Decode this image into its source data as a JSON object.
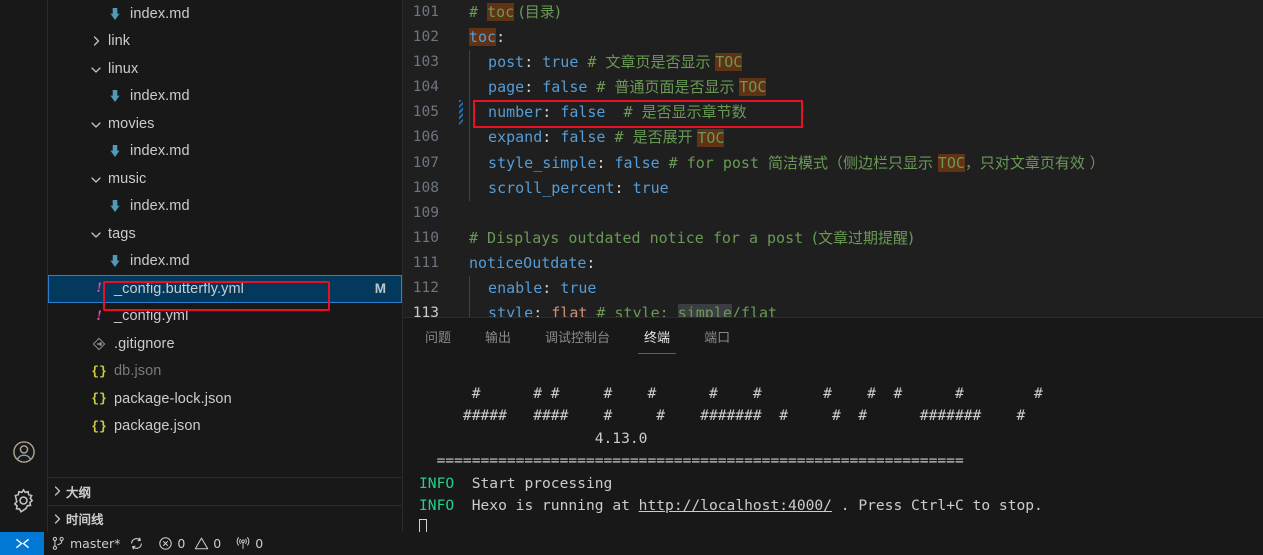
{
  "activity_bar": {
    "items": [
      {
        "name": "accounts-icon",
        "label": "帐户"
      },
      {
        "name": "settings-gear-icon",
        "label": "管理"
      }
    ]
  },
  "sidebar": {
    "tree": [
      {
        "icon": "markdown-file-icon",
        "label": "index.md",
        "indent": 3,
        "twisty": "",
        "selected": false,
        "badge": "",
        "dim": false
      },
      {
        "icon": "",
        "label": "link",
        "indent": 2,
        "twisty": "chevron-right-icon",
        "selected": false,
        "badge": "",
        "dim": false
      },
      {
        "icon": "",
        "label": "linux",
        "indent": 2,
        "twisty": "chevron-down-icon",
        "selected": false,
        "badge": "",
        "dim": false
      },
      {
        "icon": "markdown-file-icon",
        "label": "index.md",
        "indent": 3,
        "twisty": "",
        "selected": false,
        "badge": "",
        "dim": false
      },
      {
        "icon": "",
        "label": "movies",
        "indent": 2,
        "twisty": "chevron-down-icon",
        "selected": false,
        "badge": "",
        "dim": false
      },
      {
        "icon": "markdown-file-icon",
        "label": "index.md",
        "indent": 3,
        "twisty": "",
        "selected": false,
        "badge": "",
        "dim": false
      },
      {
        "icon": "",
        "label": "music",
        "indent": 2,
        "twisty": "chevron-down-icon",
        "selected": false,
        "badge": "",
        "dim": false
      },
      {
        "icon": "markdown-file-icon",
        "label": "index.md",
        "indent": 3,
        "twisty": "",
        "selected": false,
        "badge": "",
        "dim": false
      },
      {
        "icon": "",
        "label": "tags",
        "indent": 2,
        "twisty": "chevron-down-icon",
        "selected": false,
        "badge": "",
        "dim": false
      },
      {
        "icon": "markdown-file-icon",
        "label": "index.md",
        "indent": 3,
        "twisty": "",
        "selected": false,
        "badge": "",
        "dim": false
      },
      {
        "icon": "yaml-file-icon",
        "label": "_config.butterfly.yml",
        "indent": 2,
        "twisty": "",
        "selected": true,
        "badge": "M",
        "dim": false
      },
      {
        "icon": "yaml-file-icon",
        "label": "_config.yml",
        "indent": 2,
        "twisty": "",
        "selected": false,
        "badge": "",
        "dim": false
      },
      {
        "icon": "git-file-icon",
        "label": ".gitignore",
        "indent": 2,
        "twisty": "",
        "selected": false,
        "badge": "",
        "dim": false
      },
      {
        "icon": "json-file-icon",
        "label": "db.json",
        "indent": 2,
        "twisty": "",
        "selected": false,
        "badge": "",
        "dim": true
      },
      {
        "icon": "json-file-icon",
        "label": "package-lock.json",
        "indent": 2,
        "twisty": "",
        "selected": false,
        "badge": "",
        "dim": false
      },
      {
        "icon": "json-file-icon",
        "label": "package.json",
        "indent": 2,
        "twisty": "",
        "selected": false,
        "badge": "",
        "dim": false
      }
    ],
    "sections": [
      {
        "label": "大纲",
        "icon": "chevron-right-icon"
      },
      {
        "label": "时间线",
        "icon": "chevron-right-icon"
      }
    ]
  },
  "editor": {
    "lines": [
      {
        "num": "101",
        "active": false,
        "modified": false,
        "indent_guides": 0,
        "tokens": [
          {
            "t": "# ",
            "c": "cmt"
          },
          {
            "t": "toc",
            "c": "cmt mark"
          },
          {
            "t": " (目录)",
            "c": "cmt cjk"
          }
        ]
      },
      {
        "num": "102",
        "active": false,
        "modified": false,
        "indent_guides": 0,
        "tokens": [
          {
            "t": "toc",
            "c": "k mark"
          },
          {
            "t": ":",
            "c": "pun"
          }
        ]
      },
      {
        "num": "103",
        "active": false,
        "modified": false,
        "indent_guides": 1,
        "tokens": [
          {
            "t": "  post",
            "c": "k"
          },
          {
            "t": ": ",
            "c": "pun"
          },
          {
            "t": "true",
            "c": "val"
          },
          {
            "t": " # ",
            "c": "cmt"
          },
          {
            "t": "文章页是否显示 ",
            "c": "cmt cjk"
          },
          {
            "t": "TOC",
            "c": "cmt mark"
          }
        ]
      },
      {
        "num": "104",
        "active": false,
        "modified": false,
        "indent_guides": 1,
        "tokens": [
          {
            "t": "  page",
            "c": "k"
          },
          {
            "t": ": ",
            "c": "pun"
          },
          {
            "t": "false",
            "c": "val"
          },
          {
            "t": " # ",
            "c": "cmt"
          },
          {
            "t": "普通页面是否显示 ",
            "c": "cmt cjk"
          },
          {
            "t": "TOC",
            "c": "cmt mark"
          }
        ]
      },
      {
        "num": "105",
        "active": false,
        "modified": true,
        "indent_guides": 1,
        "tokens": [
          {
            "t": "  number",
            "c": "k"
          },
          {
            "t": ": ",
            "c": "pun"
          },
          {
            "t": "false",
            "c": "val"
          },
          {
            "t": "  # ",
            "c": "cmt"
          },
          {
            "t": "是否显示章节数",
            "c": "cmt cjk"
          }
        ]
      },
      {
        "num": "106",
        "active": false,
        "modified": false,
        "indent_guides": 1,
        "tokens": [
          {
            "t": "  expand",
            "c": "k"
          },
          {
            "t": ": ",
            "c": "pun"
          },
          {
            "t": "false",
            "c": "val"
          },
          {
            "t": " # ",
            "c": "cmt"
          },
          {
            "t": "是否展开 ",
            "c": "cmt cjk"
          },
          {
            "t": "TOC",
            "c": "cmt mark"
          }
        ]
      },
      {
        "num": "107",
        "active": false,
        "modified": false,
        "indent_guides": 1,
        "tokens": [
          {
            "t": "  style_simple",
            "c": "k"
          },
          {
            "t": ": ",
            "c": "pun"
          },
          {
            "t": "false",
            "c": "val"
          },
          {
            "t": " # for post ",
            "c": "cmt"
          },
          {
            "t": "简洁模式（侧边栏只显示 ",
            "c": "cmt cjk"
          },
          {
            "t": "TOC",
            "c": "cmt mark"
          },
          {
            "t": "，只对文章页有效 ）",
            "c": "cmt cjk"
          }
        ]
      },
      {
        "num": "108",
        "active": false,
        "modified": false,
        "indent_guides": 1,
        "tokens": [
          {
            "t": "  scroll_percent",
            "c": "k"
          },
          {
            "t": ": ",
            "c": "pun"
          },
          {
            "t": "true",
            "c": "val"
          }
        ]
      },
      {
        "num": "109",
        "active": false,
        "modified": false,
        "indent_guides": 0,
        "tokens": []
      },
      {
        "num": "110",
        "active": false,
        "modified": false,
        "indent_guides": 0,
        "tokens": [
          {
            "t": "# Displays outdated notice for a post ",
            "c": "cmt"
          },
          {
            "t": "(文章过期提醒)",
            "c": "cmt cjk"
          }
        ]
      },
      {
        "num": "111",
        "active": false,
        "modified": false,
        "indent_guides": 0,
        "tokens": [
          {
            "t": "noticeOutdate",
            "c": "k"
          },
          {
            "t": ":",
            "c": "pun"
          }
        ]
      },
      {
        "num": "112",
        "active": false,
        "modified": false,
        "indent_guides": 1,
        "tokens": [
          {
            "t": "  enable",
            "c": "k"
          },
          {
            "t": ": ",
            "c": "pun"
          },
          {
            "t": "true",
            "c": "val"
          }
        ]
      },
      {
        "num": "113",
        "active": true,
        "modified": false,
        "indent_guides": 1,
        "tokens": [
          {
            "t": "  style",
            "c": "k"
          },
          {
            "t": ": ",
            "c": "pun"
          },
          {
            "t": "flat",
            "c": "str"
          },
          {
            "t": " # style: ",
            "c": "cmt"
          },
          {
            "t": "simple",
            "c": "cmt sel-word"
          },
          {
            "t": "/flat",
            "c": "cmt"
          }
        ]
      }
    ]
  },
  "panel": {
    "tabs": [
      {
        "label": "问题",
        "active": false
      },
      {
        "label": "输出",
        "active": false
      },
      {
        "label": "调试控制台",
        "active": false
      },
      {
        "label": "终端",
        "active": true
      },
      {
        "label": "端口",
        "active": false
      }
    ],
    "terminal": {
      "ascii_line1": "      #      # #     #    #      #    #       #    #  #      #        #",
      "ascii_line2": "     #####   ####    #     #    #######  #     #  #      #######    #",
      "version": "                    4.13.0",
      "divider": "  ============================================================",
      "lines": [
        {
          "tag": "INFO",
          "text": "Start processing"
        },
        {
          "tag": "INFO",
          "text": "Hexo is running at ",
          "link": "http://localhost:4000/",
          "suffix": " . Press Ctrl+C to stop."
        }
      ]
    }
  },
  "statusbar": {
    "remote_label": "remote-indicator",
    "branch": "master*",
    "sync_icon": "sync-icon",
    "errors": "0",
    "warnings": "0",
    "ports": "0"
  },
  "colors": {
    "accent": "#0078d4",
    "selection_bg": "#04395e",
    "highlight_box": "#e81123",
    "search_match": "#613214",
    "info_green": "#23d18b"
  }
}
